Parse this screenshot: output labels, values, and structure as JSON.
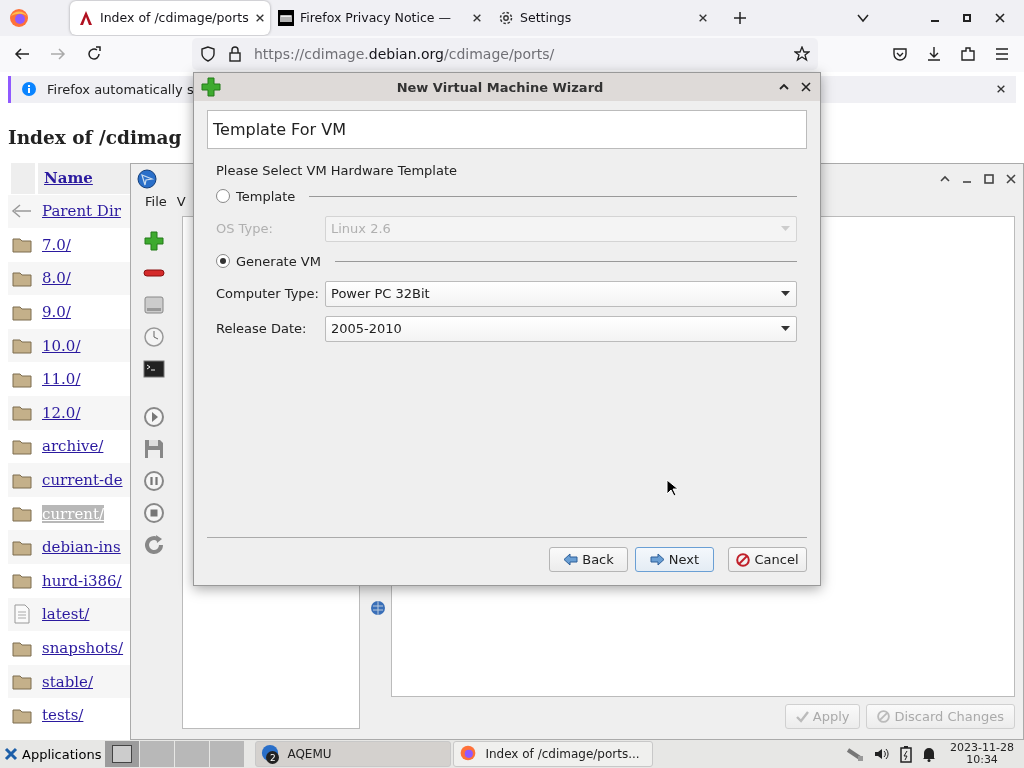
{
  "browser": {
    "tabs": [
      {
        "title": "Index of /cdimage/ports",
        "selected": true,
        "kind": "debian"
      },
      {
        "title": "Firefox Privacy Notice —",
        "selected": false,
        "kind": "mozilla"
      },
      {
        "title": "Settings",
        "selected": false,
        "kind": "settings"
      }
    ],
    "url": {
      "scheme": "https://cdimage.",
      "domain": "debian.org",
      "path": "/cdimage/ports/"
    },
    "notification": "Firefox automatically s",
    "page": {
      "heading": "Index of /cdimag",
      "column": "Name",
      "rows": [
        {
          "name": "Parent Dir",
          "kind": "parent",
          "highlighted": false
        },
        {
          "name": "7.0/",
          "kind": "folder",
          "highlighted": false
        },
        {
          "name": "8.0/",
          "kind": "folder",
          "highlighted": false
        },
        {
          "name": "9.0/",
          "kind": "folder",
          "highlighted": false
        },
        {
          "name": "10.0/",
          "kind": "folder",
          "highlighted": false
        },
        {
          "name": "11.0/",
          "kind": "folder",
          "highlighted": false
        },
        {
          "name": "12.0/",
          "kind": "folder",
          "highlighted": false
        },
        {
          "name": "archive/",
          "kind": "folder",
          "highlighted": false
        },
        {
          "name": "current-de",
          "kind": "folder",
          "highlighted": false
        },
        {
          "name": "current/",
          "kind": "folder",
          "highlighted": true
        },
        {
          "name": "debian-ins",
          "kind": "folder",
          "highlighted": false
        },
        {
          "name": "hurd-i386/",
          "kind": "folder",
          "highlighted": false
        },
        {
          "name": "latest/",
          "kind": "file",
          "highlighted": false
        },
        {
          "name": "snapshots/",
          "kind": "folder",
          "highlighted": false
        },
        {
          "name": "stable/",
          "kind": "folder",
          "highlighted": false
        },
        {
          "name": "tests/",
          "kind": "folder",
          "highlighted": false
        }
      ]
    }
  },
  "aqemu": {
    "menu": [
      "File",
      "V"
    ],
    "buttons": [
      {
        "label": "Apply",
        "disabled": true,
        "kind": "apply"
      },
      {
        "label": "Discard Changes",
        "disabled": true,
        "kind": "discard"
      }
    ]
  },
  "wizard": {
    "title": "New Virtual Machine Wizard",
    "header": "Template For VM",
    "prompt": "Please Select VM Hardware Template",
    "options": [
      {
        "label": "Template",
        "selected": false,
        "fields": [
          {
            "label": "OS Type:",
            "value": "Linux 2.6",
            "disabled": true
          }
        ]
      },
      {
        "label": "Generate VM",
        "selected": true,
        "fields": [
          {
            "label": "Computer Type:",
            "value": "Power PC 32Bit",
            "disabled": false
          },
          {
            "label": "Release Date:",
            "value": "2005-2010",
            "disabled": false
          }
        ]
      }
    ],
    "buttons": [
      {
        "label": "Back",
        "kind": "back",
        "default": false
      },
      {
        "label": "Next",
        "kind": "next",
        "default": true
      },
      {
        "label": "Cancel",
        "kind": "cancel",
        "default": false
      }
    ]
  },
  "taskbar": {
    "menu": "Applications",
    "workspaces": [
      {
        "selected": true
      },
      {
        "selected": false
      },
      {
        "selected": false
      },
      {
        "selected": false
      }
    ],
    "tasks": [
      {
        "title": "AQEMU",
        "badge": "2",
        "kind": "aqemu",
        "selected": true
      },
      {
        "title": "Index of /cdimage/ports...",
        "kind": "firefox",
        "selected": false
      }
    ],
    "date": "2023-11-28",
    "time": "10:34"
  }
}
